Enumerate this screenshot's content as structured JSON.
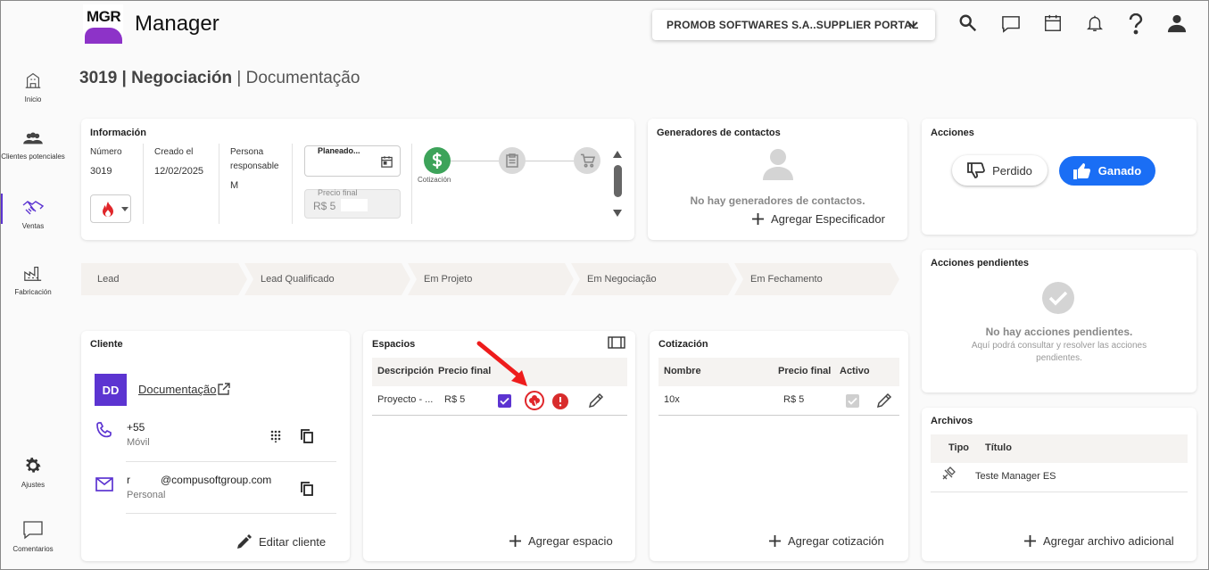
{
  "app": {
    "logo_text": "MGR",
    "title": "Manager"
  },
  "header": {
    "portal_label": "PROMOB SOFTWARES S.A..SUPPLIER PORTAL",
    "icons": [
      "search-icon",
      "chat-icon",
      "calendar-icon",
      "bell-icon",
      "help-icon",
      "user-icon"
    ]
  },
  "sidebar": {
    "items": [
      {
        "label": "Inicio",
        "icon": "building-icon"
      },
      {
        "label": "Clientes potenciales",
        "icon": "people-icon"
      },
      {
        "label": "Ventas",
        "icon": "handshake-icon",
        "active": true
      },
      {
        "label": "Fabricación",
        "icon": "factory-icon"
      },
      {
        "label": "Ajustes",
        "icon": "gear-icon"
      },
      {
        "label": "Comentarios",
        "icon": "comment-icon"
      }
    ]
  },
  "page": {
    "title_bold": "3019 | Negociación",
    "title_sep": " | ",
    "title_rest": "Documentação"
  },
  "info": {
    "title": "Información",
    "numero_label": "Número",
    "numero_value": "3019",
    "creado_label": "Creado el",
    "creado_value": "12/02/2025",
    "persona_label": "Persona responsable",
    "persona_value": "M",
    "planeado_label": "Planeado...",
    "precio_label": "Precio final",
    "precio_value": "R$ 5",
    "step_label": "Cotización"
  },
  "contactos": {
    "title": "Generadores de contactos",
    "empty": "No hay generadores de contactos.",
    "add": "Agregar Especificador"
  },
  "acciones": {
    "title": "Acciones",
    "lost": "Perdido",
    "won": "Ganado"
  },
  "pendientes": {
    "title": "Acciones pendientes",
    "empty": "No hay acciones pendientes.",
    "desc": "Aquí podrá consultar y resolver las acciones pendientes."
  },
  "pipeline": {
    "stages": [
      "Lead",
      "Lead Qualificado",
      "Em Projeto",
      "Em Negociação",
      "Em Fechamento"
    ]
  },
  "cliente": {
    "title": "Cliente",
    "initials": "DD",
    "name": "Documentação",
    "phone": "+55",
    "phone_type": "Móvil",
    "email_user": "r",
    "email_domain": "@compusoftgroup.com",
    "email_type": "Personal",
    "edit": "Editar cliente"
  },
  "espacios": {
    "title": "Espacios",
    "headers": [
      "Descripción",
      "Precio final"
    ],
    "rows": [
      {
        "desc": "Proyecto - ...",
        "price": "R$ 5"
      }
    ],
    "add": "Agregar espacio"
  },
  "cotizacion": {
    "title": "Cotización",
    "headers": [
      "Nombre",
      "Precio final",
      "Activo"
    ],
    "rows": [
      {
        "name": "10x",
        "price": "R$ 5"
      }
    ],
    "add": "Agregar cotización"
  },
  "archivos": {
    "title": "Archivos",
    "headers": [
      "Tipo",
      "Título"
    ],
    "rows": [
      {
        "title": "Teste Manager ES"
      }
    ],
    "add": "Agregar archivo adicional"
  },
  "colors": {
    "accent": "#1a6ef5",
    "brand": "#8d33c8",
    "success": "#3da35a",
    "danger": "#e0262a",
    "avatar": "#5c34d1"
  }
}
